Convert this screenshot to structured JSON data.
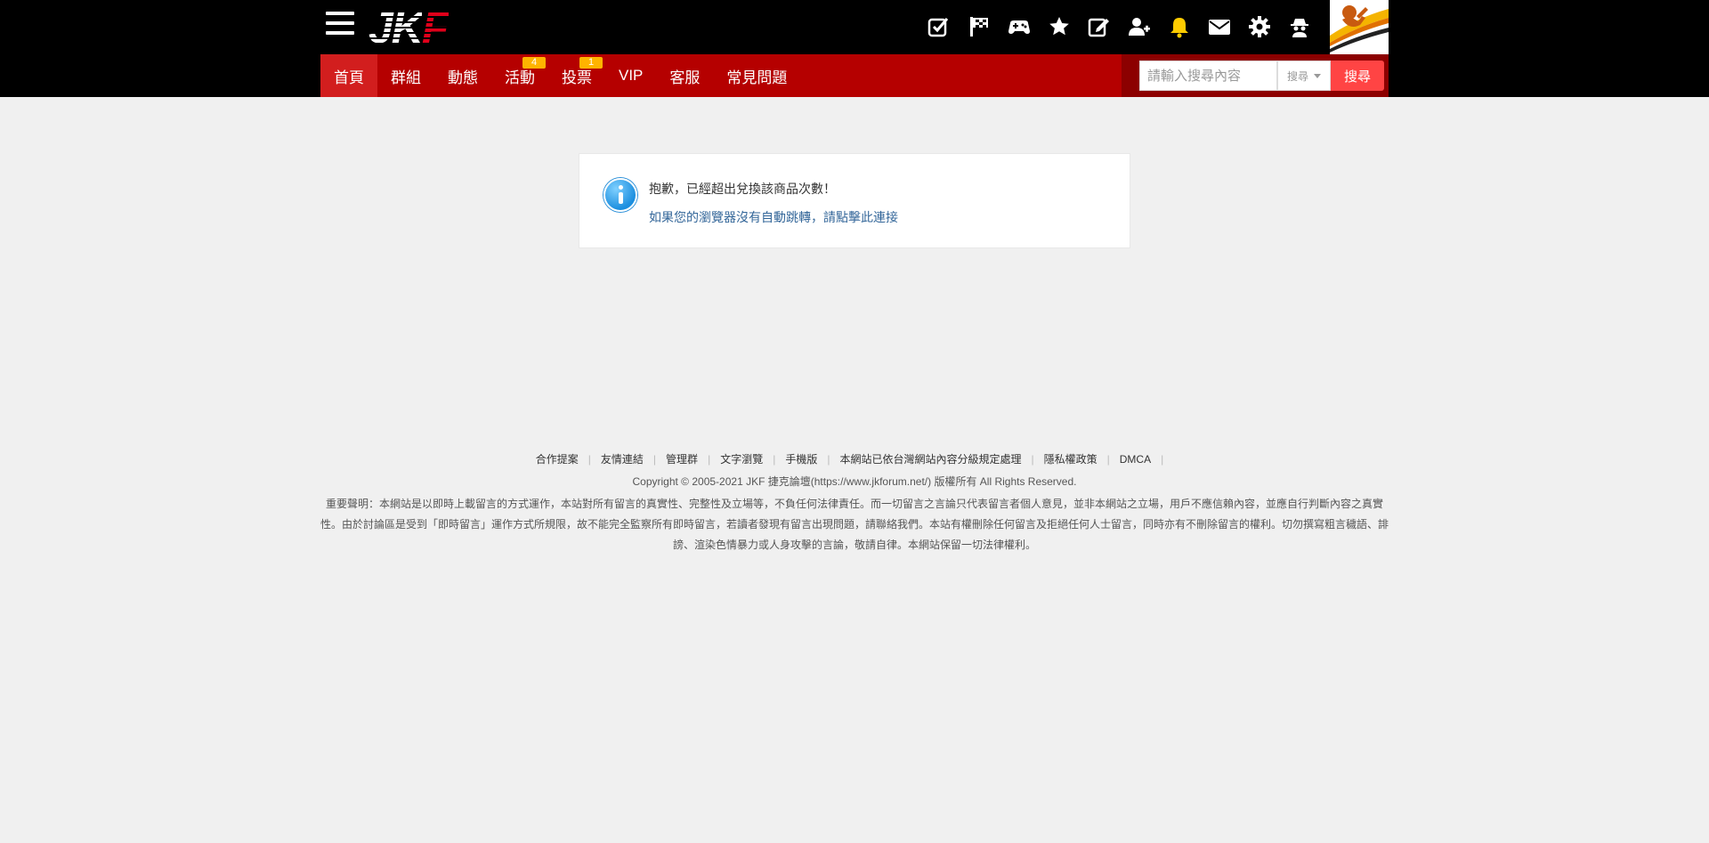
{
  "header": {
    "logo": {
      "left": "JK",
      "right": "F"
    },
    "icons": [
      {
        "name": "checkbox-icon"
      },
      {
        "name": "flag-icon"
      },
      {
        "name": "gamepad-icon"
      },
      {
        "name": "star-icon"
      },
      {
        "name": "edit-icon"
      },
      {
        "name": "add-user-icon"
      },
      {
        "name": "bell-icon"
      },
      {
        "name": "mail-icon"
      },
      {
        "name": "gear-icon"
      },
      {
        "name": "spy-icon"
      }
    ]
  },
  "nav": {
    "items": [
      {
        "label": "首頁"
      },
      {
        "label": "群組"
      },
      {
        "label": "動態"
      },
      {
        "label": "活動",
        "badge": "4"
      },
      {
        "label": "投票",
        "badge": "1"
      },
      {
        "label": "VIP"
      },
      {
        "label": "客服"
      },
      {
        "label": "常見問題"
      }
    ]
  },
  "search": {
    "placeholder": "請輸入搜尋內容",
    "select_label": "搜尋",
    "button_label": "搜尋"
  },
  "notice": {
    "message": "抱歉，已經超出兌換該商品次數！",
    "link": "如果您的瀏覽器沒有自動跳轉，請點擊此連接"
  },
  "footer": {
    "links": [
      {
        "label": "合作提案"
      },
      {
        "label": "友情連結"
      },
      {
        "label": "管理群"
      },
      {
        "label": "文字瀏覽"
      },
      {
        "label": "手機版"
      },
      {
        "label": "本網站已依台灣網站內容分級規定處理"
      },
      {
        "label": "隱私權政策"
      },
      {
        "label": "DMCA"
      }
    ],
    "copyright": "Copyright © 2005-2021 JKF 捷克論壇(https://www.jkforum.net/) 版權所有 All Rights Reserved.",
    "disclaimer": "重要聲明：本網站是以即時上載留言的方式運作，本站對所有留言的真實性、完整性及立場等，不負任何法律責任。而一切留言之言論只代表留言者個人意見，並非本網站之立場，用戶不應信賴內容，並應自行判斷內容之真實性。由於討論區是受到「即時留言」運作方式所規限，故不能完全監察所有即時留言，若讀者發現有留言出現問題，請聯絡我們。本站有權刪除任何留言及拒絕任何人士留言，同時亦有不刪除留言的權利。切勿撰寫粗言穢語、誹謗、渲染色情暴力或人身攻擊的言論，敬請自律。本網站保留一切法律權利。"
  },
  "colors": {
    "nav_bg": "#b50000",
    "nav_active": "#d21e1e",
    "badge": "#ffb400",
    "search_button": "#ff4444",
    "bell": "#ffcc00",
    "link": "#336699"
  }
}
